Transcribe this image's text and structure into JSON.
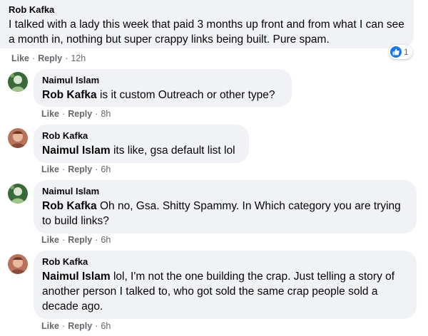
{
  "actions": {
    "like": "Like",
    "reply": "Reply",
    "separator": "·"
  },
  "comments": [
    {
      "author": "Rob Kafka",
      "text": "I talked with a lady this week that paid 3 months up front and from what I can see a month in, nothing but super crappy links being built. Pure spam.",
      "time": "12h",
      "reaction_count": "1",
      "reaction_icon": "like-icon"
    },
    {
      "author": "Naimul Islam",
      "mention": "Rob Kafka",
      "text": "is it custom Outreach or other type?",
      "time": "8h"
    },
    {
      "author": "Rob Kafka",
      "mention": "Naimul Islam",
      "text": "its like, gsa default list lol",
      "time": "6h"
    },
    {
      "author": "Naimul Islam",
      "mention": "Rob Kafka",
      "text": "Oh no, Gsa. Shitty Spammy. In Which category you are trying to build links?",
      "time": "6h"
    },
    {
      "author": "Rob Kafka",
      "mention": "Naimul Islam",
      "text": "lol, I'm not the one building the crap. Just telling a story of another person I talked to, who got sold the same crap people sold a decade ago.",
      "time": "6h"
    }
  ],
  "colors": {
    "bubble": "#f0f2f5",
    "meta": "#65676b",
    "like_blue": "#1877f2"
  }
}
